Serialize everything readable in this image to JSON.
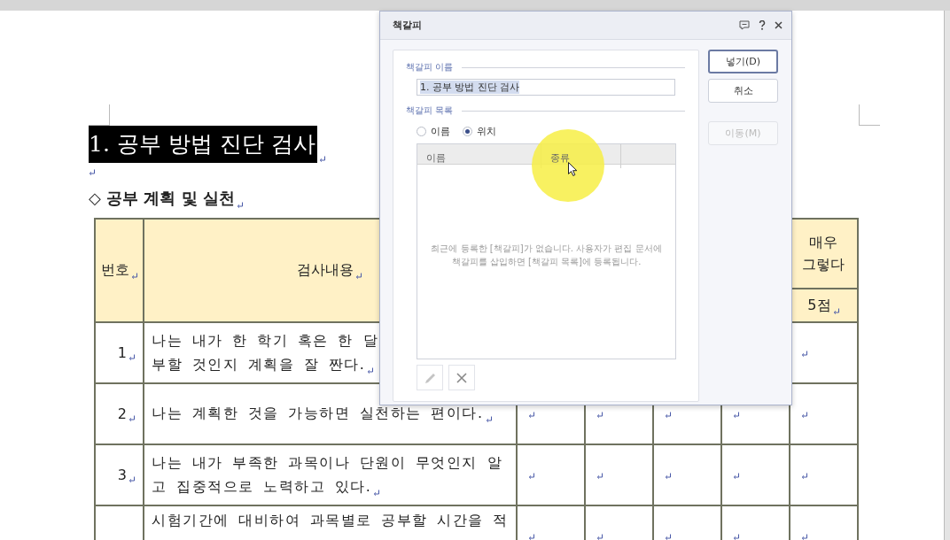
{
  "document": {
    "heading": "1. 공부 방법 진단 검사",
    "subheading": "◇ 공부 계획 및 실천",
    "table": {
      "header": {
        "number": "번호",
        "content": "검사내용",
        "last_score": [
          "매우",
          "그렇다"
        ],
        "last_points": "5점"
      },
      "rows": [
        {
          "number": "1",
          "lines": [
            "나는 내가 한 학기 혹은 한 달",
            "부할 것인지 계획을 잘 짠다."
          ]
        },
        {
          "number": "2",
          "lines": [
            "나는 계획한 것을 가능하면 실천하는 편이다."
          ]
        },
        {
          "number": "3",
          "lines": [
            "나는 내가 부족한 과목이나 단원이 무엇인지 알",
            "고 집중적으로 노력하고 있다."
          ]
        },
        {
          "lines": [
            "시험기간에 대비하여 과목별로 공부할 시간을 적"
          ]
        }
      ]
    }
  },
  "dialog": {
    "title": "책갈피",
    "name_section": {
      "label": "책갈피 이름",
      "value": "1. 공부 방법 진단 검사"
    },
    "list_section": {
      "label": "책갈피 목록",
      "sort": [
        {
          "label": "이름",
          "selected": false
        },
        {
          "label": "위치",
          "selected": true
        }
      ],
      "columns": [
        "이름",
        "종류"
      ],
      "empty_message": "최근에 등록한 [책갈피]가 없습니다. 사용자가 편집 문서에 책갈피를 삽입하면 [책갈피 목록]에 등록됩니다."
    },
    "tools": [
      {
        "kind": "edit",
        "disabled": true
      },
      {
        "kind": "delete",
        "disabled": false
      }
    ],
    "buttons": [
      {
        "label": "넣기(D)",
        "default": true,
        "disabled": false
      },
      {
        "label": "취소",
        "default": false,
        "disabled": false
      },
      {
        "label": "이동(M)",
        "default": false,
        "disabled": true
      }
    ]
  }
}
